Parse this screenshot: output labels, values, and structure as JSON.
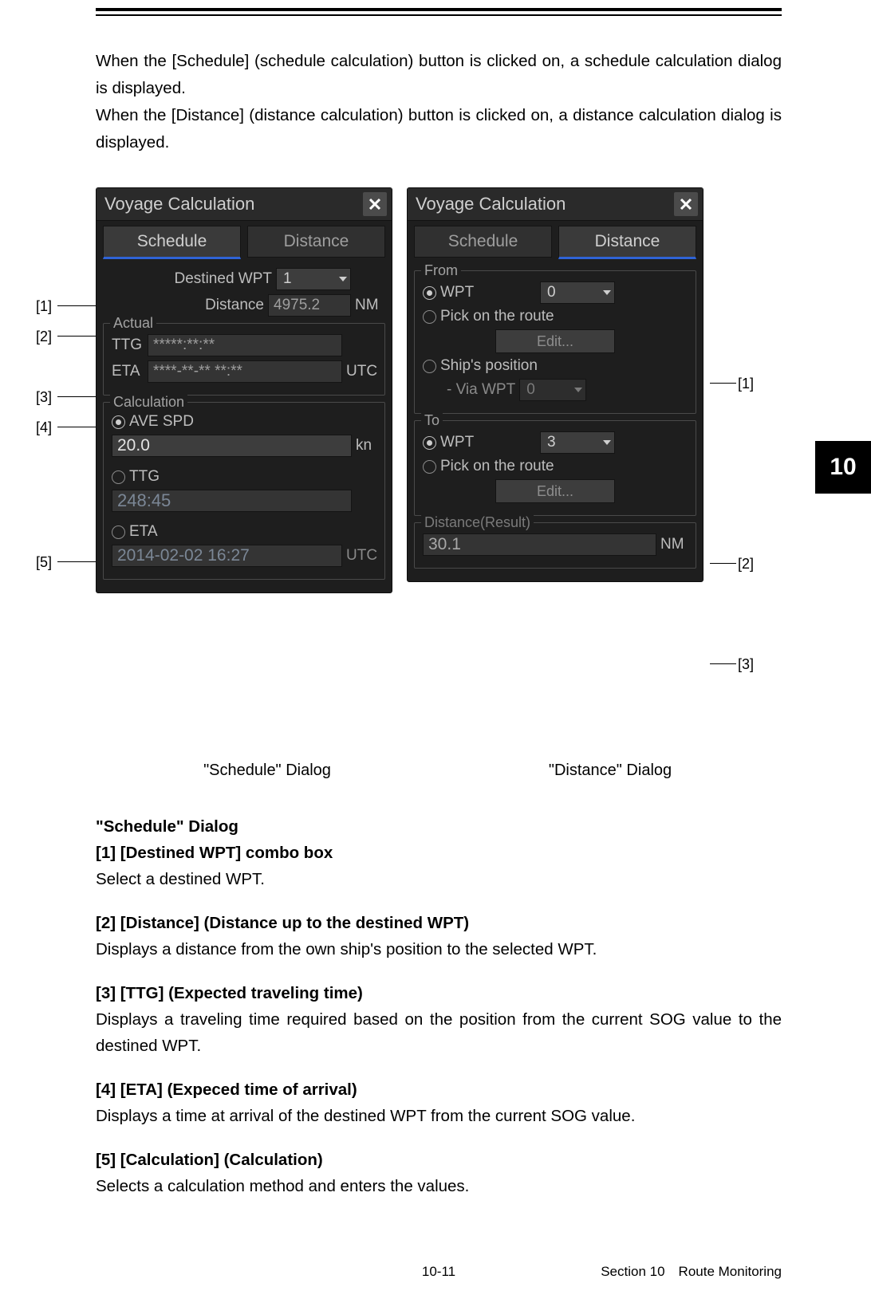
{
  "chapter_tab": "10",
  "intro": {
    "p1": "When the [Schedule] (schedule calculation) button is clicked on, a schedule calculation dialog is displayed.",
    "p2": "When the [Distance] (distance calculation) button is clicked on, a distance calculation dialog is displayed."
  },
  "figure": {
    "annot_left": {
      "a1": "[1]",
      "a2": "[2]",
      "a3": "[3]",
      "a4": "[4]",
      "a5": "[5]"
    },
    "annot_right": {
      "a1": "[1]",
      "a2": "[2]",
      "a3": "[3]"
    },
    "caption_schedule": "\"Schedule\" Dialog",
    "caption_distance": "\"Distance\" Dialog"
  },
  "schedule_panel": {
    "title": "Voyage Calculation",
    "tab_schedule": "Schedule",
    "tab_distance": "Distance",
    "destined_wpt_label": "Destined WPT",
    "destined_wpt_value": "1",
    "distance_label": "Distance",
    "distance_value": "4975.2",
    "distance_unit": "NM",
    "actual_legend": "Actual",
    "ttg_label": "TTG",
    "ttg_value": "*****:**:**",
    "eta_label": "ETA",
    "eta_value": "****-**-** **:**",
    "eta_unit": "UTC",
    "calc_legend": "Calculation",
    "ave_spd_label": "AVE SPD",
    "ave_spd_value": "20.0",
    "ave_spd_unit": "kn",
    "calc_ttg_label": "TTG",
    "calc_ttg_value": "248:45",
    "calc_eta_label": "ETA",
    "calc_eta_value": "2014-02-02 16:27",
    "calc_eta_unit": "UTC"
  },
  "distance_panel": {
    "title": "Voyage Calculation",
    "tab_schedule": "Schedule",
    "tab_distance": "Distance",
    "from_legend": "From",
    "from_wpt_label": "WPT",
    "from_wpt_value": "0",
    "pick_route_label": "Pick on the route",
    "edit_label": "Edit...",
    "ship_pos_label": "Ship's position",
    "via_wpt_label": "- Via WPT",
    "via_wpt_value": "0",
    "to_legend": "To",
    "to_wpt_label": "WPT",
    "to_wpt_value": "3",
    "result_legend": "Distance(Result)",
    "result_value": "30.1",
    "result_unit": "NM"
  },
  "defs": {
    "heading": "\"Schedule\" Dialog",
    "d1_h": "[1] [Destined WPT] combo box",
    "d1_t": "Select a destined WPT.",
    "d2_h": "[2] [Distance] (Distance up to the destined WPT)",
    "d2_t": "Displays a distance from the own ship's position to the selected WPT.",
    "d3_h": "[3] [TTG] (Expected traveling time)",
    "d3_t": "Displays a traveling time required based on the position from the current SOG value to the destined WPT.",
    "d4_h": "[4] [ETA] (Expeced time of arrival)",
    "d4_t": "Displays a time at arrival of the destined WPT from the current SOG value.",
    "d5_h": "[5] [Calculation] (Calculation)",
    "d5_t": "Selects a calculation method and enters the values."
  },
  "footer": {
    "page": "10-11",
    "section": "Section 10 Route Monitoring"
  }
}
